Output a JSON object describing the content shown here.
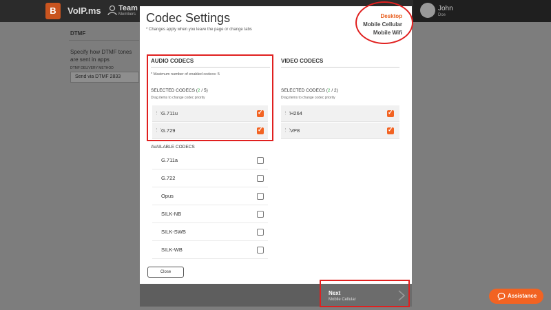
{
  "topbar": {
    "logo_letter": "B",
    "brand": "VoIP.ms",
    "team_title": "Team",
    "team_sub": "Members",
    "user_name": "John",
    "user_sub": "Doe"
  },
  "background": {
    "dtmf_title": "DTMF",
    "dtmf_desc": "Specify how DTMF tones are sent in apps",
    "method_label": "DTMF DELIVERY METHOD",
    "method_value": "Send via DTMF 2833"
  },
  "modal": {
    "title": "Codec Settings",
    "note": "* Changes apply when you leave the page or change tabs",
    "device_tabs": [
      {
        "label": "Desktop",
        "active": true
      },
      {
        "label": "Mobile Cellular",
        "active": false
      },
      {
        "label": "Mobile Wifi",
        "active": false
      }
    ],
    "audio": {
      "heading": "AUDIO CODECS",
      "max_note": "* Maximum number of enabled codecs: 5",
      "selected_prefix": "SELECTED CODECS (",
      "selected_count": "2",
      "selected_suffix": " / 5)",
      "drag_note": "Drag items to change codec priority",
      "selected": [
        {
          "name": "G.711u",
          "checked": true
        },
        {
          "name": "G.729",
          "checked": true
        }
      ],
      "available_heading": "AVAILABLE CODECS",
      "available": [
        {
          "name": "G.711a",
          "checked": false
        },
        {
          "name": "G.722",
          "checked": false
        },
        {
          "name": "Opus",
          "checked": false
        },
        {
          "name": "SILK-NB",
          "checked": false
        },
        {
          "name": "SILK-SWB",
          "checked": false
        },
        {
          "name": "SILK-WB",
          "checked": false
        }
      ]
    },
    "video": {
      "heading": "VIDEO CODECS",
      "selected_prefix": "SELECTED CODECS (",
      "selected_count": "2",
      "selected_suffix": " / 2)",
      "drag_note": "Drag items to change codec priority",
      "selected": [
        {
          "name": "H264",
          "checked": true
        },
        {
          "name": "VP8",
          "checked": true
        }
      ]
    },
    "close_label": "Close",
    "next_label": "Next",
    "next_sub": "Mobile Cellular"
  },
  "assistance_label": "Assistance",
  "colors": {
    "accent": "#f26322",
    "active_tab": "#e85d1c",
    "highlight": "#e0201f",
    "count_green": "#3cb050"
  }
}
